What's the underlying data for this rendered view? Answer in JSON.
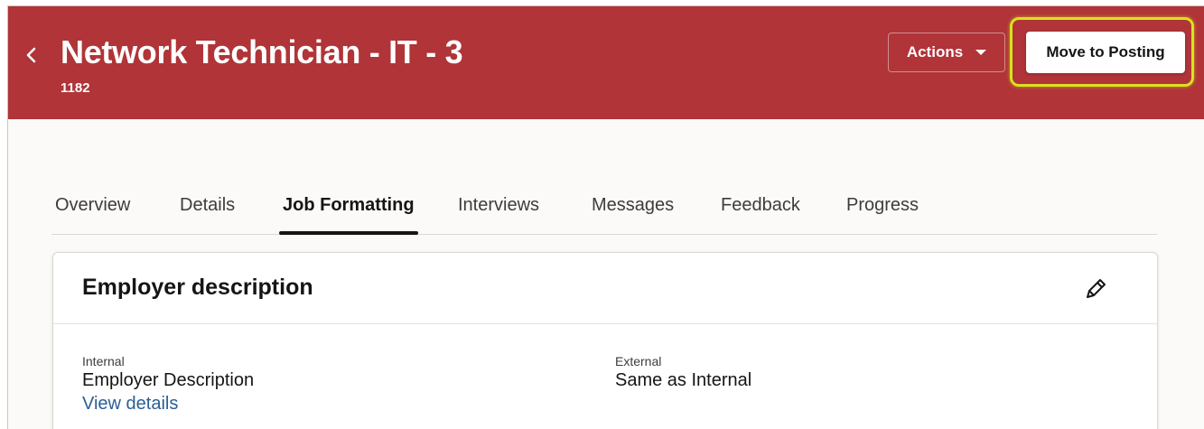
{
  "header": {
    "title": "Network Technician - IT - 3",
    "subtitle": "1182",
    "back_icon": "chevron-left-icon",
    "actions_label": "Actions",
    "move_label": "Move to Posting",
    "background_color": "#b03438",
    "highlight_color": "#d8e21e"
  },
  "tabs": [
    {
      "label": "Overview"
    },
    {
      "label": "Details"
    },
    {
      "label": "Job Formatting",
      "active": true
    },
    {
      "label": "Interviews"
    },
    {
      "label": "Messages"
    },
    {
      "label": "Feedback"
    },
    {
      "label": "Progress"
    }
  ],
  "card": {
    "title": "Employer description",
    "edit_icon": "pencil-icon",
    "internal": {
      "label": "Internal",
      "value": "Employer Description",
      "link": "View details"
    },
    "external": {
      "label": "External",
      "value": "Same as Internal"
    }
  }
}
